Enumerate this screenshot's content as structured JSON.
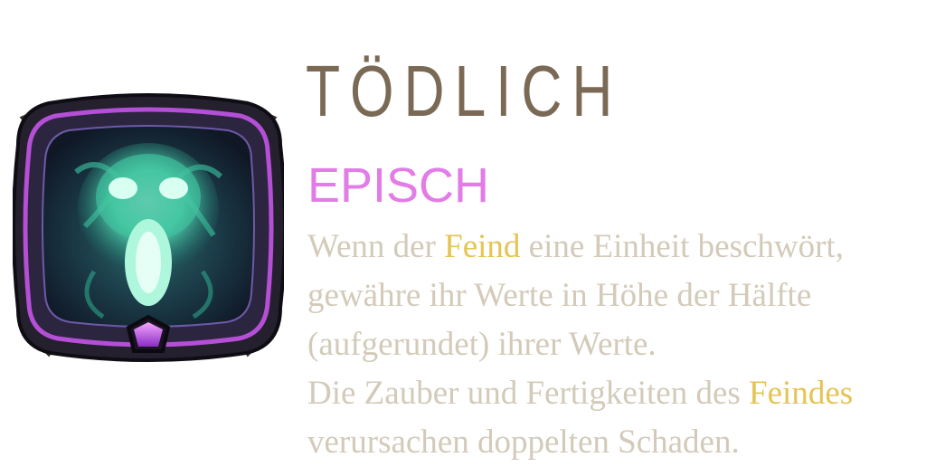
{
  "card": {
    "icon": "ghost-skull-emblem-icon",
    "title": "TÖDLICH",
    "rarity": "EPISCH",
    "description": {
      "line1": {
        "a": "Wenn der ",
        "hl": "Feind",
        "b": " eine Einheit beschwört,"
      },
      "line2": "gewähre ihr Werte in Höhe der Hälfte",
      "line3": "(aufgerundet) ihrer Werte.",
      "line4": {
        "a": "Die Zauber und Fertigkeiten des ",
        "hl": "Feindes"
      },
      "line5": "verursachen doppelten Schaden."
    }
  },
  "colors": {
    "title": "#7a6a55",
    "rarity": "#e27ce6",
    "description": "#d3cab9",
    "highlight": "#e5c453",
    "frame_purple": "#b44fd6",
    "frame_gold": "#9a8460",
    "glow": "#5ef0c0"
  }
}
